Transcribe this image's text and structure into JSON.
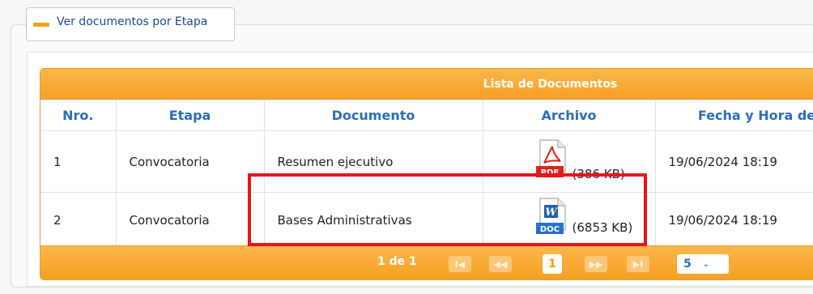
{
  "panel": {
    "toggle_label": "Ver documentos por Etapa"
  },
  "table": {
    "caption": "Lista de Documentos",
    "columns": [
      "Nro.",
      "Etapa",
      "Documento",
      "Archivo",
      "Fecha y Hora de"
    ],
    "rows": [
      {
        "nro": "1",
        "etapa": "Convocatoria",
        "documento": "Resumen ejecutivo",
        "file_type": "PDF",
        "file_size": "(386 KB)",
        "fecha": "19/06/2024 18:19"
      },
      {
        "nro": "2",
        "etapa": "Convocatoria",
        "documento": "Bases Administrativas",
        "file_type": "DOC",
        "file_size": "(6853 KB)",
        "fecha": "19/06/2024 18:19"
      }
    ]
  },
  "pager": {
    "info": "1 de 1",
    "first": "I◀",
    "prev": "◀◀",
    "current": "1",
    "next": "▶▶",
    "last": "▶I",
    "page_size": "5",
    "chevron": "⌄"
  },
  "icons": {
    "pdf": "pdf-file-icon",
    "doc": "word-doc-icon"
  },
  "colors": {
    "accent_orange": "#f7a126",
    "header_blue": "#2a6fb7",
    "highlight_red": "#e8141b"
  }
}
